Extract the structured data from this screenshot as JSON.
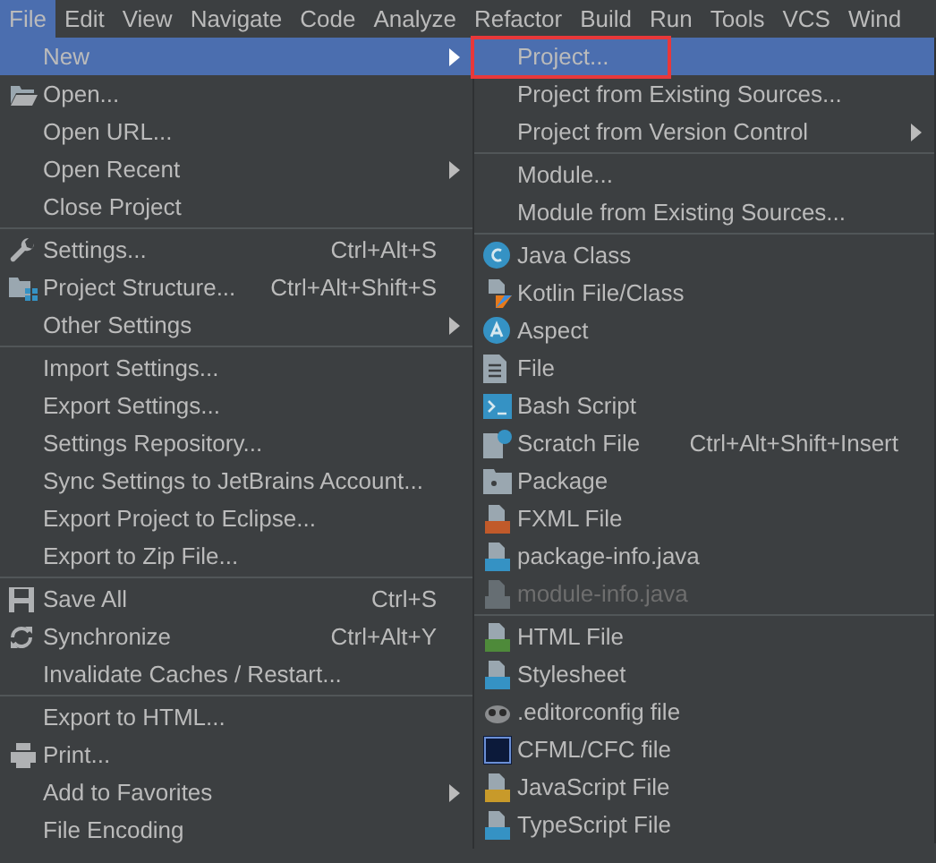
{
  "menu_bar": [
    {
      "label": "File",
      "selected": true
    },
    {
      "label": "Edit",
      "selected": false
    },
    {
      "label": "View",
      "selected": false
    },
    {
      "label": "Navigate",
      "selected": false
    },
    {
      "label": "Code",
      "selected": false
    },
    {
      "label": "Analyze",
      "selected": false
    },
    {
      "label": "Refactor",
      "selected": false
    },
    {
      "label": "Build",
      "selected": false
    },
    {
      "label": "Run",
      "selected": false
    },
    {
      "label": "Tools",
      "selected": false
    },
    {
      "label": "VCS",
      "selected": false
    },
    {
      "label": "Wind",
      "selected": false
    }
  ],
  "file_menu": [
    {
      "kind": "item",
      "label": "New",
      "has_submenu": true,
      "selected": true
    },
    {
      "kind": "item",
      "label": "Open...",
      "has_submenu": false,
      "selected": false
    },
    {
      "kind": "item",
      "label": "Open URL...",
      "has_submenu": false,
      "selected": false
    },
    {
      "kind": "item",
      "label": "Open Recent",
      "has_submenu": true,
      "selected": false
    },
    {
      "kind": "item",
      "label": "Close Project",
      "has_submenu": false,
      "selected": false
    },
    {
      "kind": "separator"
    },
    {
      "kind": "item",
      "label": "Settings...",
      "shortcut": "Ctrl+Alt+S",
      "has_submenu": false,
      "selected": false
    },
    {
      "kind": "item",
      "label": "Project Structure...",
      "shortcut": "Ctrl+Alt+Shift+S",
      "has_submenu": false,
      "selected": false
    },
    {
      "kind": "item",
      "label": "Other Settings",
      "has_submenu": true,
      "selected": false
    },
    {
      "kind": "separator"
    },
    {
      "kind": "item",
      "label": "Import Settings...",
      "has_submenu": false,
      "selected": false
    },
    {
      "kind": "item",
      "label": "Export Settings...",
      "has_submenu": false,
      "selected": false
    },
    {
      "kind": "item",
      "label": "Settings Repository...",
      "has_submenu": false,
      "selected": false
    },
    {
      "kind": "item",
      "label": "Sync Settings to JetBrains Account...",
      "has_submenu": false,
      "selected": false
    },
    {
      "kind": "item",
      "label": "Export Project to Eclipse...",
      "has_submenu": false,
      "selected": false
    },
    {
      "kind": "item",
      "label": "Export to Zip File...",
      "has_submenu": false,
      "selected": false
    },
    {
      "kind": "separator"
    },
    {
      "kind": "item",
      "label": "Save All",
      "shortcut": "Ctrl+S",
      "has_submenu": false,
      "selected": false
    },
    {
      "kind": "item",
      "label": "Synchronize",
      "shortcut": "Ctrl+Alt+Y",
      "has_submenu": false,
      "selected": false
    },
    {
      "kind": "item",
      "label": "Invalidate Caches / Restart...",
      "has_submenu": false,
      "selected": false
    },
    {
      "kind": "separator"
    },
    {
      "kind": "item",
      "label": "Export to HTML...",
      "has_submenu": false,
      "selected": false
    },
    {
      "kind": "item",
      "label": "Print...",
      "has_submenu": false,
      "selected": false
    },
    {
      "kind": "item",
      "label": "Add to Favorites",
      "has_submenu": true,
      "selected": false
    },
    {
      "kind": "item",
      "label": "File Encoding",
      "has_submenu": false,
      "selected": false
    }
  ],
  "new_submenu": [
    {
      "kind": "item",
      "label": "Project...",
      "has_submenu": false,
      "selected": true,
      "disabled": false
    },
    {
      "kind": "item",
      "label": "Project from Existing Sources...",
      "has_submenu": false,
      "selected": false,
      "disabled": false
    },
    {
      "kind": "item",
      "label": "Project from Version Control",
      "has_submenu": true,
      "selected": false,
      "disabled": false
    },
    {
      "kind": "separator"
    },
    {
      "kind": "item",
      "label": "Module...",
      "has_submenu": false,
      "selected": false,
      "disabled": false
    },
    {
      "kind": "item",
      "label": "Module from Existing Sources...",
      "has_submenu": false,
      "selected": false,
      "disabled": false
    },
    {
      "kind": "separator"
    },
    {
      "kind": "item",
      "label": "Java Class",
      "has_submenu": false,
      "selected": false,
      "disabled": false
    },
    {
      "kind": "item",
      "label": "Kotlin File/Class",
      "has_submenu": false,
      "selected": false,
      "disabled": false
    },
    {
      "kind": "item",
      "label": "Aspect",
      "has_submenu": false,
      "selected": false,
      "disabled": false
    },
    {
      "kind": "item",
      "label": "File",
      "has_submenu": false,
      "selected": false,
      "disabled": false
    },
    {
      "kind": "item",
      "label": "Bash Script",
      "has_submenu": false,
      "selected": false,
      "disabled": false
    },
    {
      "kind": "item",
      "label": "Scratch File",
      "shortcut": "Ctrl+Alt+Shift+Insert",
      "has_submenu": false,
      "selected": false,
      "disabled": false
    },
    {
      "kind": "item",
      "label": "Package",
      "has_submenu": false,
      "selected": false,
      "disabled": false
    },
    {
      "kind": "item",
      "label": "FXML File",
      "has_submenu": false,
      "selected": false,
      "disabled": false
    },
    {
      "kind": "item",
      "label": "package-info.java",
      "has_submenu": false,
      "selected": false,
      "disabled": false
    },
    {
      "kind": "item",
      "label": "module-info.java",
      "has_submenu": false,
      "selected": false,
      "disabled": true
    },
    {
      "kind": "separator"
    },
    {
      "kind": "item",
      "label": "HTML File",
      "has_submenu": false,
      "selected": false,
      "disabled": false
    },
    {
      "kind": "item",
      "label": "Stylesheet",
      "has_submenu": false,
      "selected": false,
      "disabled": false
    },
    {
      "kind": "item",
      "label": ".editorconfig file",
      "has_submenu": false,
      "selected": false,
      "disabled": false
    },
    {
      "kind": "item",
      "label": "CFML/CFC file",
      "has_submenu": false,
      "selected": false,
      "disabled": false
    },
    {
      "kind": "item",
      "label": "JavaScript File",
      "has_submenu": false,
      "selected": false,
      "disabled": false
    },
    {
      "kind": "item",
      "label": "TypeScript File",
      "has_submenu": false,
      "selected": false,
      "disabled": false
    }
  ]
}
